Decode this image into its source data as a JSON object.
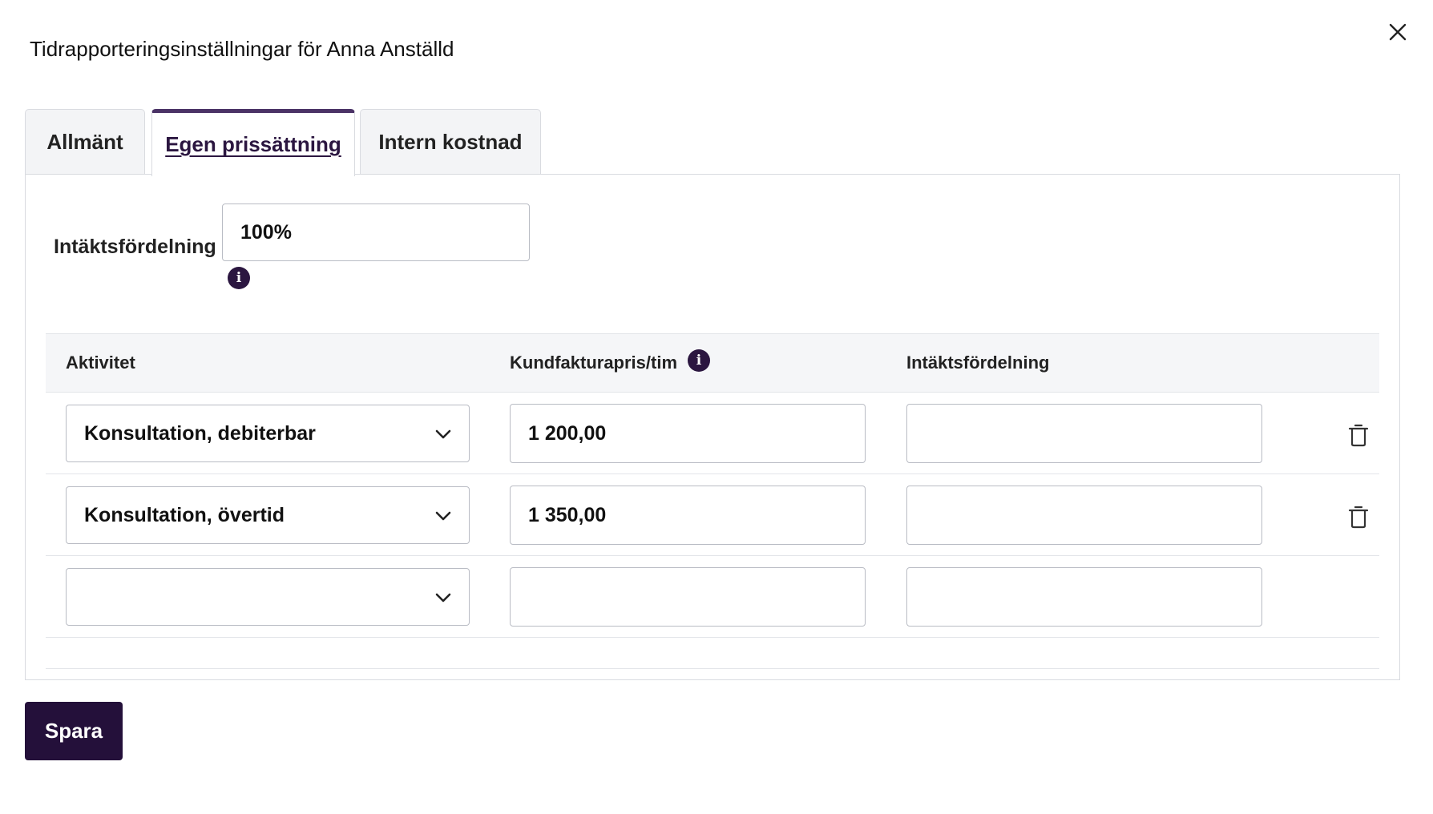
{
  "dialog": {
    "title": "Tidrapporteringsinställningar för Anna Anställd"
  },
  "tabs": [
    {
      "label": "Allmänt",
      "active": false
    },
    {
      "label": "Egen prissättning",
      "active": true
    },
    {
      "label": "Intern kostnad",
      "active": false
    }
  ],
  "revenue_share": {
    "label": "Intäktsfördelning",
    "value": "100%",
    "info_icon": "info-icon"
  },
  "table": {
    "columns": [
      "Aktivitet",
      "Kundfakturapris/tim",
      "Intäktsfördelning"
    ],
    "rows": [
      {
        "activity": "Konsultation, debiterbar",
        "price": "1 200,00",
        "revenue_share": ""
      },
      {
        "activity": "Konsultation, övertid",
        "price": "1 350,00",
        "revenue_share": ""
      },
      {
        "activity": "",
        "price": "",
        "revenue_share": ""
      }
    ]
  },
  "actions": {
    "save_label": "Spara"
  },
  "colors": {
    "primary": "#24103a",
    "active_tab_border": "#4b3366",
    "info_icon_bg": "#2b1640",
    "header_bg": "#f5f6f8"
  }
}
